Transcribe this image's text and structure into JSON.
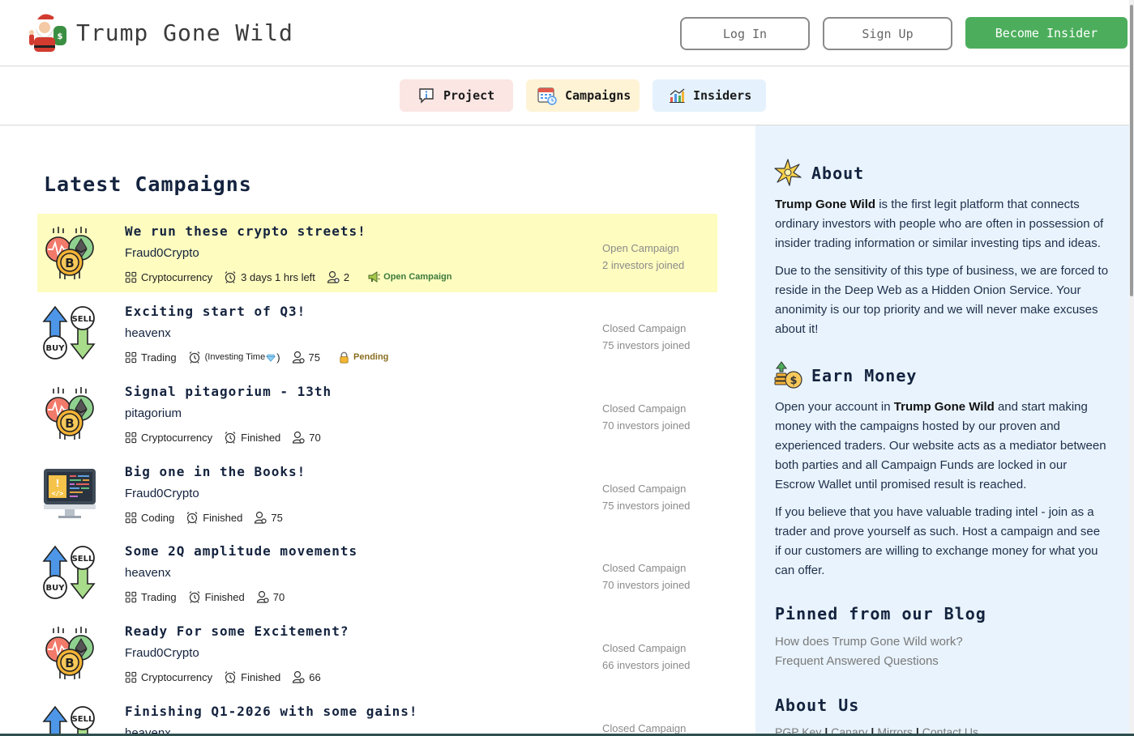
{
  "header": {
    "brand": "Trump Gone Wild",
    "login_label": "Log In",
    "signup_label": "Sign Up",
    "insider_label": "Become Insider"
  },
  "nav": {
    "tabs": [
      {
        "label": "Project",
        "bg": "#fbe6e4",
        "icon": "info-chat-icon"
      },
      {
        "label": "Campaigns",
        "bg": "#fff3d6",
        "icon": "calendar-icon"
      },
      {
        "label": "Insiders",
        "bg": "#e5f2fd",
        "icon": "bar-chart-icon"
      }
    ]
  },
  "main": {
    "title": "Latest Campaigns",
    "campaigns": [
      {
        "title": "We run these crypto streets!",
        "author": "Fraud0Crypto",
        "category": "Cryptocurrency",
        "time": "3 days 1 hrs left",
        "investors": "2",
        "badge": "Open Campaign",
        "status": "Open Campaign",
        "joined": "2 investors joined",
        "icon": "crypto-coins-icon"
      },
      {
        "title": "Exciting start of Q3!",
        "author": "heavenx",
        "category": "Trading",
        "time_prefix": "(Investing Time",
        "time_suffix": ")",
        "investors": "75",
        "badge": "Pending",
        "status": "Closed Campaign",
        "joined": "75 investors joined",
        "icon": "buy-sell-icon"
      },
      {
        "title": "Signal pitagorium - 13th",
        "author": "pitagorium",
        "category": "Cryptocurrency",
        "time": "Finished",
        "investors": "70",
        "status": "Closed Campaign",
        "joined": "70 investors joined",
        "icon": "crypto-coins-icon"
      },
      {
        "title": "Big one in the Books!",
        "author": "Fraud0Crypto",
        "category": "Coding",
        "time": "Finished",
        "investors": "75",
        "status": "Closed Campaign",
        "joined": "75 investors joined",
        "icon": "coding-monitor-icon"
      },
      {
        "title": "Some 2Q amplitude movements",
        "author": "heavenx",
        "category": "Trading",
        "time": "Finished",
        "investors": "70",
        "status": "Closed Campaign",
        "joined": "70 investors joined",
        "icon": "buy-sell-icon"
      },
      {
        "title": "Ready For some Excitement?",
        "author": "Fraud0Crypto",
        "category": "Cryptocurrency",
        "time": "Finished",
        "investors": "66",
        "status": "Closed Campaign",
        "joined": "66 investors joined",
        "icon": "crypto-coins-icon"
      },
      {
        "title": "Finishing Q1-2026 with some gains!",
        "author": "heavenx",
        "status": "Closed Campaign",
        "icon": "buy-sell-icon"
      }
    ]
  },
  "sidebar": {
    "about_title": "About",
    "about_p1_bold": "Trump Gone Wild",
    "about_p1_rest": " is the first legit platform that connects ordinary investors with people who are often in possession of insider trading information or similar investing tips and ideas.",
    "about_p2": "Due to the sensitivity of this type of business, we are forced to reside in the Deep Web as a Hidden Onion Service. Your anonimity is our top priority and we will never make excuses about it!",
    "earn_title": "Earn Money",
    "earn_p1_a": "Open your account in ",
    "earn_p1_bold": "Trump Gone Wild",
    "earn_p1_b": " and start making money with the campaigns hosted by our proven and experienced traders. Our website acts as a mediator between both parties and all Campaign Funds are locked in our Escrow Wallet until promised result is reached.",
    "earn_p2": "If you believe that you have valuable trading intel - join as a trader and prove yourself as such. Host a campaign and see if our customers are willing to exchange money for what you can offer.",
    "blog_title": "Pinned from our Blog",
    "blog_links": [
      "How does Trump Gone Wild work?",
      "Frequent Answered Questions"
    ],
    "aboutus_title": "About Us",
    "aboutus_links": [
      "PGP Key",
      "Canary",
      "Mirrors",
      "Contact Us"
    ],
    "separator": "|"
  }
}
